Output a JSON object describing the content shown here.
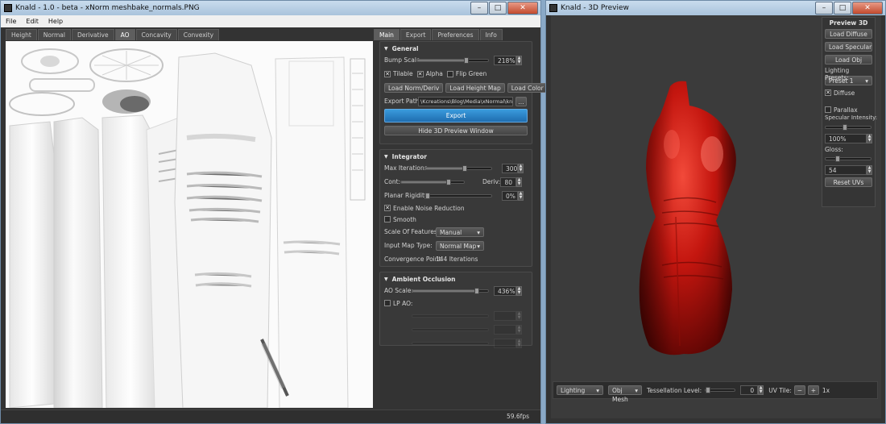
{
  "left_window": {
    "title": "Knald - 1.0 - beta - xNorm meshbake_normals.PNG",
    "min": "–",
    "max": "□",
    "close": "✕",
    "menu": [
      "File",
      "Edit",
      "Help"
    ],
    "view_tabs": [
      "Height",
      "Normal",
      "Derivative",
      "AO",
      "Concavity",
      "Convexity"
    ],
    "active_view_tab": "AO",
    "panel_tabs": [
      "Main",
      "Export",
      "Preferences",
      "Info"
    ],
    "active_panel_tab": "Main",
    "fps": "59.6fps"
  },
  "general": {
    "header": "General",
    "bump_scale_label": "Bump Scale",
    "bump_scale_value": "218%",
    "bump_scale_level": 0.7,
    "tileable": "Tilable",
    "alpha": "Alpha",
    "flip_green": "Flip Green",
    "tileable_checked": true,
    "alpha_checked": true,
    "flip_green_checked": false,
    "load_norm": "Load Norm/Deriv",
    "load_height": "Load Height Map",
    "load_color": "Load Color Map",
    "export_path_label": "Export Path:",
    "export_path_value": "\\Kcreations\\Blog\\Media\\xNormal\\knald",
    "browse": "...",
    "export": "Export",
    "hide_preview": "Hide 3D Preview Window"
  },
  "integrator": {
    "header": "Integrator",
    "max_iter_label": "Max Iterations:",
    "max_iter_value": "300",
    "max_iter_level": 0.6,
    "cont_label": "Cont:",
    "cont_level": 0.75,
    "deriv_label": "Deriv:",
    "deriv_value": "80",
    "planar_label": "Planar Rigidity:",
    "planar_value": "0%",
    "planar_level": 0.0,
    "noise_reduction": "Enable Noise Reduction",
    "noise_checked": true,
    "smooth": "Smooth",
    "smooth_checked": false,
    "scale_features_label": "Scale Of Features:",
    "scale_features_value": "Manual",
    "input_map_label": "Input Map Type:",
    "input_map_value": "Normal Map",
    "convergence_label": "Convergence Point:",
    "convergence_value": "144 Iterations"
  },
  "ao": {
    "header": "Ambient Occlusion",
    "ao_scale_label": "AO Scale:",
    "ao_scale_value": "436%",
    "ao_scale_level": 0.85,
    "lp_ao": "LP AO:",
    "lp_checked": false
  },
  "right_window": {
    "title": "Knald - 3D Preview",
    "min": "–",
    "max": "□",
    "close": "✕"
  },
  "preview3d": {
    "header": "Preview 3D",
    "load_diffuse": "Load Diffuse",
    "load_specular": "Load Specular",
    "load_obj": "Load Obj",
    "lighting_presets_label": "Lighting Presets:",
    "lighting_preset_value": "Preset 1",
    "diffuse": "Diffuse",
    "diffuse_checked": true,
    "parallax": "Parallax",
    "parallax_checked": false,
    "specular_label": "Specular Intensity:",
    "specular_value": "100%",
    "specular_level": 0.4,
    "gloss_label": "Gloss:",
    "gloss_value": "54",
    "gloss_level": 0.25,
    "reset_uvs": "Reset UVs"
  },
  "bottom": {
    "lighting": "Lighting",
    "obj_mesh": "Obj Mesh",
    "tess_label": "Tessellation Level:",
    "tess_value": "0",
    "uv_tile_label": "UV Tile:",
    "minus": "−",
    "plus": "+",
    "uv_tile_value": "1x"
  }
}
